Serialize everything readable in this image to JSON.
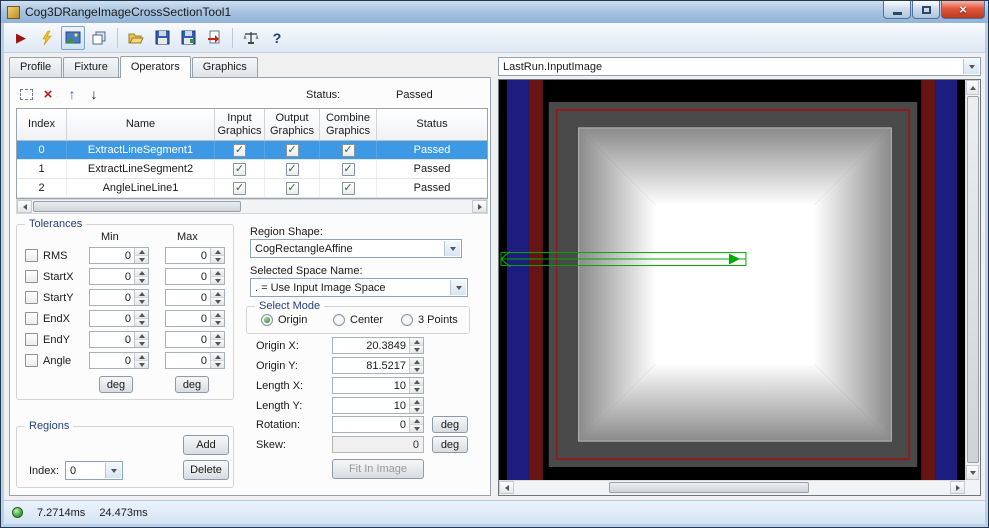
{
  "window": {
    "title": "Cog3DRangeImageCrossSectionTool1"
  },
  "icons": {
    "run": "▶",
    "delete": "×",
    "move_up": "↑",
    "move_down": "↓",
    "check": "✓",
    "help": "?",
    "close": "×"
  },
  "tabs": {
    "items": [
      {
        "label": "Profile"
      },
      {
        "label": "Fixture"
      },
      {
        "label": "Operators"
      },
      {
        "label": "Graphics"
      }
    ],
    "active": "Operators"
  },
  "display": {
    "source": "LastRun.InputImage"
  },
  "operators": {
    "status_label": "Status:",
    "status_value": "Passed",
    "table": {
      "headers": [
        "Index",
        "Name",
        "Input Graphics",
        "Output Graphics",
        "Combine Graphics",
        "Status"
      ],
      "rows": [
        {
          "index": "0",
          "name": "ExtractLineSegment1",
          "input_graphics": true,
          "output_graphics": true,
          "combine_graphics": true,
          "status": "Passed",
          "selected": true
        },
        {
          "index": "1",
          "name": "ExtractLineSegment2",
          "input_graphics": true,
          "output_graphics": true,
          "combine_graphics": true,
          "status": "Passed",
          "selected": false
        },
        {
          "index": "2",
          "name": "AngleLineLine1",
          "input_graphics": true,
          "output_graphics": true,
          "combine_graphics": true,
          "status": "Passed",
          "selected": false
        }
      ]
    }
  },
  "tolerances": {
    "title": "Tolerances",
    "min_header": "Min",
    "max_header": "Max",
    "deg_label": "deg",
    "rows": [
      {
        "label": "RMS",
        "min": "0",
        "max": "0",
        "checked": false
      },
      {
        "label": "StartX",
        "min": "0",
        "max": "0",
        "checked": false
      },
      {
        "label": "StartY",
        "min": "0",
        "max": "0",
        "checked": false
      },
      {
        "label": "EndX",
        "min": "0",
        "max": "0",
        "checked": false
      },
      {
        "label": "EndY",
        "min": "0",
        "max": "0",
        "checked": false
      },
      {
        "label": "Angle",
        "min": "0",
        "max": "0",
        "checked": false
      }
    ]
  },
  "regions": {
    "title": "Regions",
    "index_label": "Index:",
    "index_value": "0",
    "add_label": "Add",
    "delete_label": "Delete"
  },
  "shape": {
    "label": "Region Shape:",
    "value": "CogRectangleAffine"
  },
  "space": {
    "label": "Selected Space Name:",
    "value": ". = Use Input Image Space"
  },
  "mode": {
    "title": "Select Mode",
    "options": [
      "Origin",
      "Center",
      "3 Points"
    ],
    "selected": "Origin"
  },
  "fields": [
    {
      "label": "Origin X:",
      "value": "20.3849"
    },
    {
      "label": "Origin Y:",
      "value": "81.5217"
    },
    {
      "label": "Length X:",
      "value": "10"
    },
    {
      "label": "Length Y:",
      "value": "10"
    },
    {
      "label": "Rotation:",
      "value": "0"
    },
    {
      "label": "Skew:",
      "value": "0"
    }
  ],
  "fit": {
    "label": "Fit In Image"
  },
  "statusbar": {
    "time1": "7.2714ms",
    "time2": "24.473ms"
  },
  "colors": {
    "selection": "#3d99e4",
    "graphic_green": "#00aa00",
    "stripe_blue": "#1d1d80",
    "stripe_red": "#661414",
    "status_led": "#3fae3f"
  }
}
